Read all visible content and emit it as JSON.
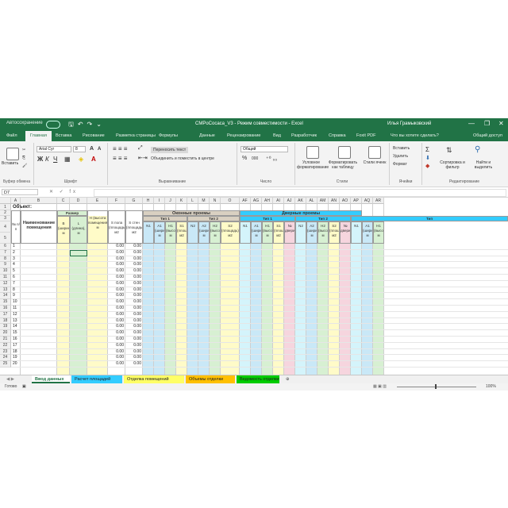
{
  "titlebar": {
    "autosave": "Автосохранение",
    "document": "CMPoCocaca_V3 - Режим совместимости - Excel",
    "user": "Илья Грамыковский",
    "minimize": "—",
    "restore": "❐",
    "close": "✕"
  },
  "tabs": [
    "Файл",
    "Главная",
    "Вставка",
    "Рисование",
    "Разметка страницы",
    "Формулы",
    "Данные",
    "Рецензирование",
    "Вид",
    "Разработчик",
    "Справка",
    "Foxit PDF"
  ],
  "tabs_right": [
    "Что вы хотите сделать?",
    "Общий доступ"
  ],
  "ribbon": {
    "clipboard": {
      "label": "Буфер обмена",
      "paste": "Вставить"
    },
    "font": {
      "label": "Шрифт",
      "font_name": "Arial Cyr",
      "font_size": "8",
      "bold": "Ж",
      "italic": "К",
      "underline": "Ч",
      "grow": "A",
      "shrink": "A"
    },
    "alignment": {
      "label": "Выравнивание",
      "wrap": "Переносить текст",
      "merge": "Объединить и поместить в центре"
    },
    "number": {
      "label": "Число",
      "format": "Общий",
      "percent": "%",
      "thousands": "000"
    },
    "styles": {
      "label": "Стили",
      "conditional": "Условное форматирование",
      "table": "Форматировать как таблицу",
      "cell": "Стили ячеек"
    },
    "cells": {
      "label": "Ячейки",
      "insert": "Вставить",
      "delete": "Удалить",
      "format": "Формат"
    },
    "editing": {
      "label": "Редактирование",
      "sort": "Сортировка и фильтр",
      "find": "Найти и выделить"
    }
  },
  "formula_bar": {
    "name_box": "D7",
    "fx": "✕ ✓ fx",
    "formula": ""
  },
  "columns": [
    "A",
    "B",
    "C",
    "D",
    "E",
    "F",
    "G",
    "H",
    "I",
    "J",
    "K",
    "L",
    "M",
    "N",
    "O",
    "AF",
    "AG",
    "AH",
    "AI",
    "AJ",
    "AK",
    "AL",
    "AM",
    "AN",
    "AO",
    "AP",
    "AQ",
    "AR"
  ],
  "sheet": {
    "object_label": "Объект:",
    "room_name_header": "Наименование помещения",
    "size_header": "Размер",
    "width_label": "В (ширина), м",
    "length_label": "L (длина), м",
    "height_label": "H (высота помещения), м",
    "area_label": "S пола (площадь), м2",
    "perimeter_label": "S стен (площадь), м2",
    "num_label": "№ п/п",
    "window_header": "Оконные проемы",
    "door_header": "Дверные проемы",
    "type1": "Тип 1",
    "type2": "Тип 2",
    "type_partial": "Тип",
    "sub_n": "N1",
    "sub_a": "A1 (ширина), м",
    "sub_h": "H1 (высота), м",
    "sub_s": "S1 (площадь), м2",
    "sub_n2": "N2",
    "sub_a2": "A2 (ширина), м",
    "sub_h2": "H2 (высота), м",
    "sub_s2": "S2 (площадь), м2",
    "sub_d": "№ двери",
    "rows": [
      {
        "row": "6",
        "n": "1",
        "f": "0.00",
        "g": "0.00"
      },
      {
        "row": "7",
        "n": "2",
        "f": "0.00",
        "g": "0.00"
      },
      {
        "row": "8",
        "n": "3",
        "f": "0.00",
        "g": "0.00"
      },
      {
        "row": "9",
        "n": "4",
        "f": "0.00",
        "g": "0.00"
      },
      {
        "row": "10",
        "n": "5",
        "f": "0.00",
        "g": "0.00"
      },
      {
        "row": "11",
        "n": "6",
        "f": "0.00",
        "g": "0.00"
      },
      {
        "row": "12",
        "n": "7",
        "f": "0.00",
        "g": "0.00"
      },
      {
        "row": "13",
        "n": "8",
        "f": "0.00",
        "g": "0.00"
      },
      {
        "row": "14",
        "n": "9",
        "f": "0.00",
        "g": "0.00"
      },
      {
        "row": "15",
        "n": "10",
        "f": "0.00",
        "g": "0.00"
      },
      {
        "row": "16",
        "n": "11",
        "f": "0.00",
        "g": "0.00"
      },
      {
        "row": "17",
        "n": "12",
        "f": "0.00",
        "g": "0.00"
      },
      {
        "row": "18",
        "n": "13",
        "f": "0.00",
        "g": "0.00"
      },
      {
        "row": "19",
        "n": "14",
        "f": "0.00",
        "g": "0.00"
      },
      {
        "row": "20",
        "n": "15",
        "f": "0.00",
        "g": "0.00"
      },
      {
        "row": "21",
        "n": "16",
        "f": "0.00",
        "g": "0.00"
      },
      {
        "row": "22",
        "n": "17",
        "f": "0.00",
        "g": "0.00"
      },
      {
        "row": "23",
        "n": "18",
        "f": "0.00",
        "g": "0.00"
      },
      {
        "row": "24",
        "n": "19",
        "f": "0.00",
        "g": "0.00"
      },
      {
        "row": "25",
        "n": "20",
        "f": "0.00",
        "g": "0.00"
      }
    ],
    "header_rows": [
      "1",
      "2",
      "3",
      "4",
      "5"
    ]
  },
  "sheet_tabs": [
    {
      "label": "Ввод данных",
      "color": "#ffffff",
      "active": true
    },
    {
      "label": "Расчет площадей",
      "color": "#33ccff"
    },
    {
      "label": "Отделка помещений",
      "color": "#ffff66"
    },
    {
      "label": "Объемы отделки",
      "color": "#ffc000"
    },
    {
      "label": "Ведомость отделки",
      "color": "#00cc00"
    }
  ],
  "status": {
    "ready": "Готово",
    "zoom": "100%"
  },
  "colors": {
    "excel_green": "#217346",
    "window_header": "#d9d0c1",
    "door_header": "#33ccff",
    "col_blue": "#c9e8f7",
    "col_yellow": "#fffbc8",
    "col_green": "#d7f0d2",
    "col_pink": "#f6d5de",
    "col_cyan_light": "#d4f4fb"
  }
}
